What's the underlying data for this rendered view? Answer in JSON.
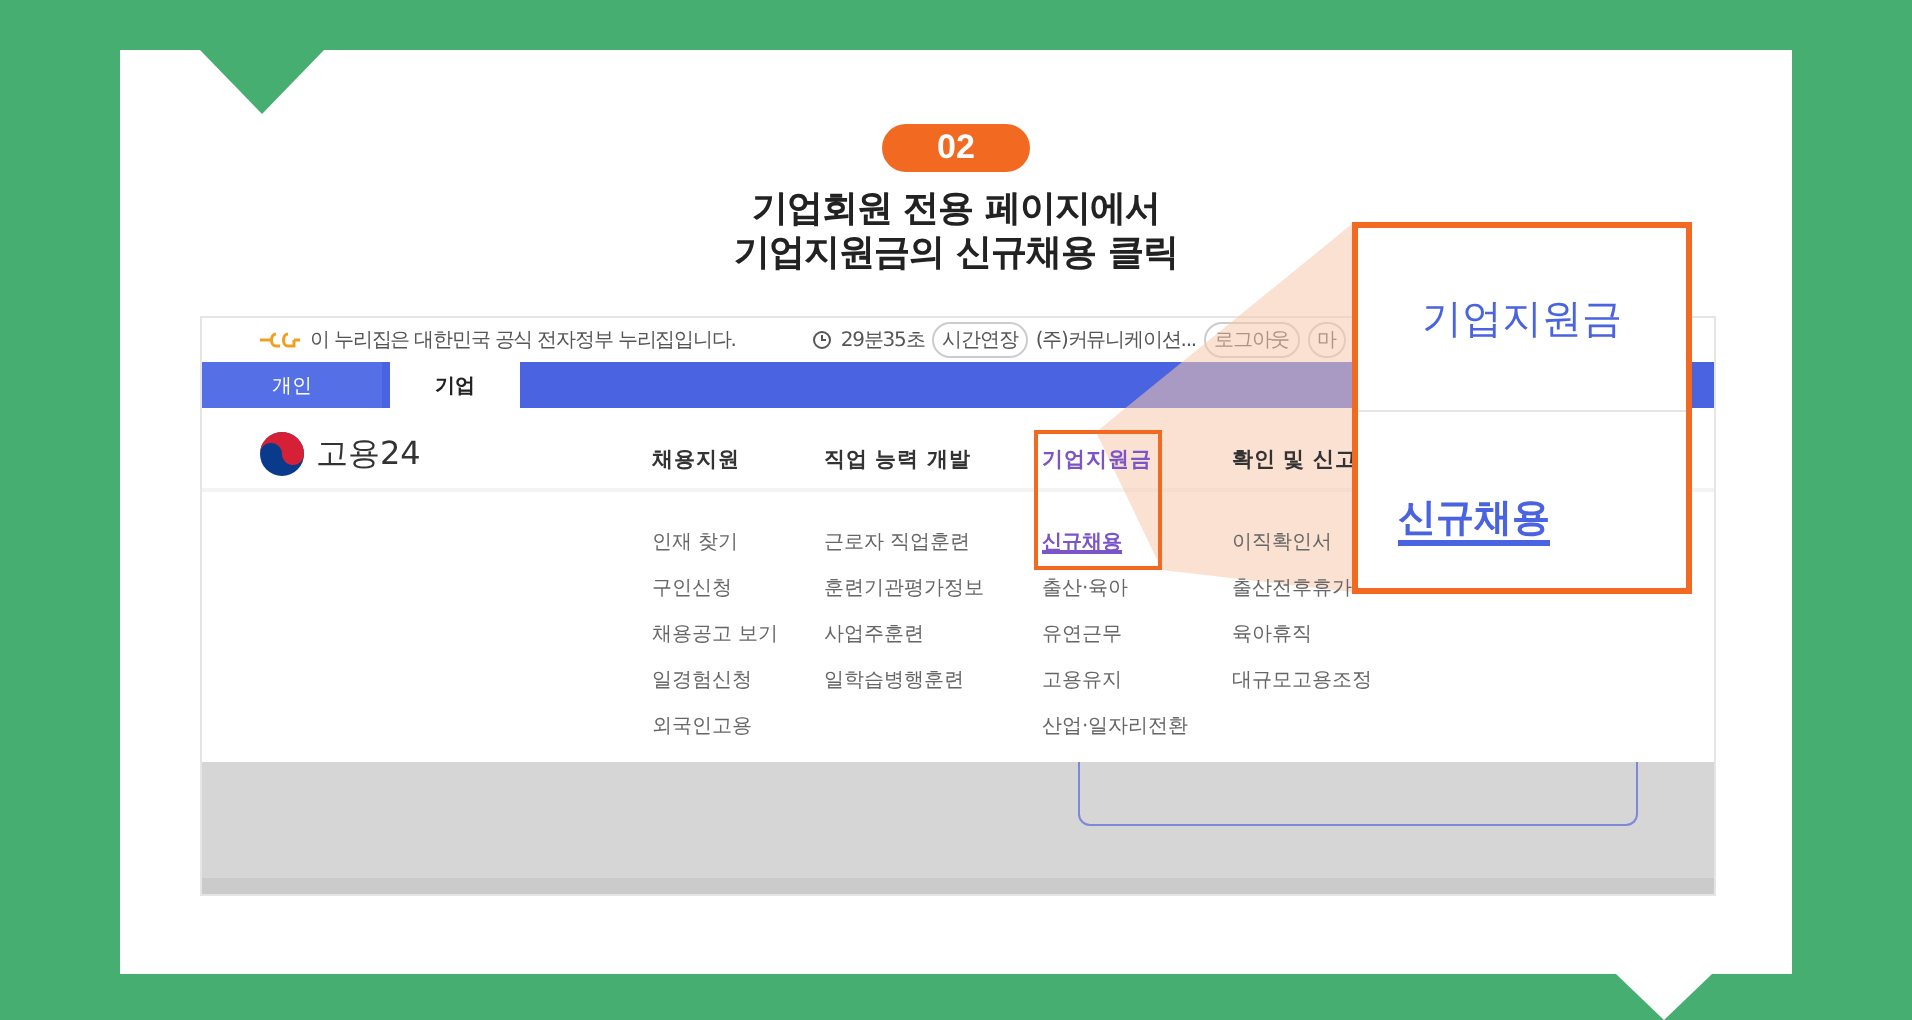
{
  "step": {
    "number": "02",
    "title_lines": [
      "기업회원 전용 페이지에서",
      "기업지원금의 신규채용 클릭"
    ]
  },
  "site": {
    "notice": "이 누리집은 대한민국 공식 전자정부 누리집입니다.",
    "timer": "29분35초",
    "extend_button": "시간연장",
    "user": "(주)커뮤니케이션...",
    "logout_button": "로그아웃",
    "my_menu": "마",
    "tabs": [
      {
        "label": "개인",
        "selected": false
      },
      {
        "label": "기업",
        "selected": true
      }
    ],
    "logo": "고용24",
    "menu": [
      {
        "title": "채용지원",
        "selected": false,
        "items": [
          {
            "label": "인재 찾기",
            "selected": false
          },
          {
            "label": "구인신청",
            "selected": false
          },
          {
            "label": "채용공고 보기",
            "selected": false
          },
          {
            "label": "일경험신청",
            "selected": false
          },
          {
            "label": "외국인고용",
            "selected": false
          }
        ]
      },
      {
        "title": "직업 능력 개발",
        "selected": false,
        "items": [
          {
            "label": "근로자 직업훈련",
            "selected": false
          },
          {
            "label": "훈련기관평가정보",
            "selected": false
          },
          {
            "label": "사업주훈련",
            "selected": false
          },
          {
            "label": "일학습병행훈련",
            "selected": false
          }
        ]
      },
      {
        "title": "기업지원금",
        "selected": true,
        "items": [
          {
            "label": "신규채용",
            "selected": true
          },
          {
            "label": "출산·육아",
            "selected": false
          },
          {
            "label": "유연근무",
            "selected": false
          },
          {
            "label": "고용유지",
            "selected": false
          },
          {
            "label": "산업·일자리전환",
            "selected": false
          }
        ]
      },
      {
        "title": "확인 및 신고",
        "selected": false,
        "items": [
          {
            "label": "이직확인서",
            "selected": false
          },
          {
            "label": "출산전후휴가",
            "selected": false
          },
          {
            "label": "육아휴직",
            "selected": false
          },
          {
            "label": "대규모고용조정",
            "selected": false
          }
        ]
      }
    ]
  },
  "callout": {
    "heading": "기업지원금",
    "link": "신규채용"
  }
}
